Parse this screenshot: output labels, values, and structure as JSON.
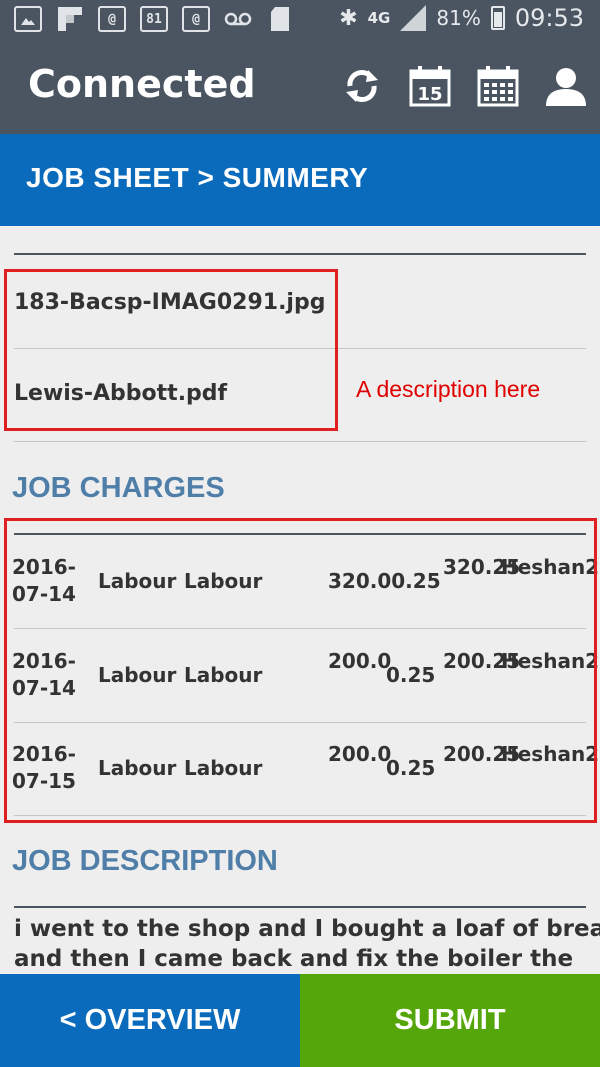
{
  "status_bar": {
    "notification_icons": [
      "image-icon",
      "flipboard-icon",
      "missed-email-icon",
      "calendar-81-icon",
      "email-icon",
      "voicemail-icon",
      "sd-card-icon"
    ],
    "calendar_badge": "81",
    "network": "4G",
    "battery": "81%",
    "time": "09:53"
  },
  "app_bar": {
    "title": "Connected",
    "actions": [
      "sync-icon",
      "calendar-day-icon",
      "calendar-month-icon",
      "profile-icon"
    ],
    "calendar_day": "15"
  },
  "breadcrumb": "JOB SHEET > SUMMERY",
  "attachments": {
    "files": [
      "183-Bacsp-IMAG0291.jpg",
      "Lewis-Abbott.pdf"
    ],
    "annotation": "A description here"
  },
  "job_charges": {
    "heading": "JOB CHARGES",
    "rows": [
      {
        "date": "2016-07-14",
        "type": "Labour",
        "description": "Labour",
        "rate": "320.0",
        "qty": "0.25",
        "rate_qty": "320.00.25",
        "total": "320.25",
        "engineer": "Heshan2"
      },
      {
        "date": "2016-07-14",
        "type": "Labour",
        "description": "Labour",
        "rate": "200.0",
        "qty": "0.25",
        "total": "200.25",
        "engineer": "Heshan2"
      },
      {
        "date": "2016-07-15",
        "type": "Labour",
        "description": "Labour",
        "rate": "200.0",
        "qty": "0.25",
        "total": "200.25",
        "engineer": "Heshan2"
      }
    ]
  },
  "job_description": {
    "heading": "JOB DESCRIPTION",
    "text_line1": "i went to the shop and I bought a loaf of bread",
    "text_line2": "and then I came back and fix the boiler the"
  },
  "footer": {
    "overview_label": "< OVERVIEW",
    "submit_label": "SUBMIT"
  },
  "colors": {
    "app_bar": "#4a5561",
    "primary_blue": "#0a6bbc",
    "submit_green": "#55a60a",
    "section_heading": "#4f7fa8",
    "annotation_red": "#e00000"
  }
}
